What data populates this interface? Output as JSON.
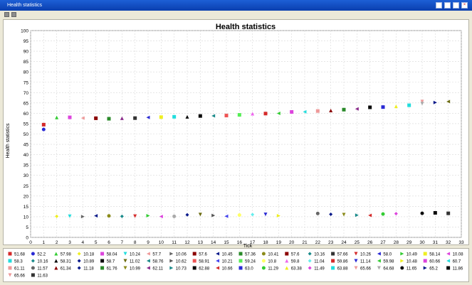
{
  "window": {
    "title": "Health statistics",
    "buttons": [
      "minimize-icon",
      "restore-icon",
      "pin-icon",
      "close-icon"
    ]
  },
  "chart_data": {
    "type": "scatter",
    "title": "Health statistics",
    "xlabel": "Tick",
    "ylabel": "Health statistics",
    "xlim": [
      0,
      33
    ],
    "ylim": [
      0,
      100
    ],
    "xticks": [
      0,
      1,
      2,
      3,
      4,
      5,
      6,
      7,
      8,
      9,
      10,
      11,
      12,
      13,
      14,
      15,
      16,
      17,
      18,
      19,
      20,
      21,
      22,
      23,
      24,
      25,
      26,
      27,
      28,
      29,
      30,
      31,
      32,
      33
    ],
    "yticks": [
      0,
      5,
      10,
      15,
      20,
      25,
      30,
      35,
      40,
      45,
      50,
      55,
      60,
      65,
      70,
      75,
      80,
      85,
      90,
      95,
      100
    ],
    "grid": true,
    "legend_position": "bottom",
    "series": [
      {
        "name": "51.68",
        "x": 1,
        "y": 54.5,
        "color": "#d42a2a",
        "shape": "square"
      },
      {
        "name": "52.2",
        "x": 1,
        "y": 52.2,
        "color": "#2a2ad4",
        "shape": "circle"
      },
      {
        "name": "57.98",
        "x": 2,
        "y": 57.98,
        "color": "#33cc33",
        "shape": "triangle-up"
      },
      {
        "name": "10.18",
        "x": 2,
        "y": 10.18,
        "color": "#eeee22",
        "shape": "diamond"
      },
      {
        "name": "58.04",
        "x": 3,
        "y": 58.04,
        "color": "#dd44dd",
        "shape": "square"
      },
      {
        "name": "10.24",
        "x": 3,
        "y": 10.24,
        "color": "#22dddd",
        "shape": "triangle-down"
      },
      {
        "name": "57.7",
        "x": 4,
        "y": 57.7,
        "color": "#ee9999",
        "shape": "triangle-left"
      },
      {
        "name": "10.06",
        "x": 4,
        "y": 10.06,
        "color": "#666666",
        "shape": "triangle-right"
      },
      {
        "name": "57.6",
        "x": 5,
        "y": 57.6,
        "color": "#8b0000",
        "shape": "square"
      },
      {
        "name": "10.45",
        "x": 5,
        "y": 10.45,
        "color": "#0a1a8a",
        "shape": "triangle-left"
      },
      {
        "name": "57.36",
        "x": 6,
        "y": 57.36,
        "color": "#2a8a2a",
        "shape": "square"
      },
      {
        "name": "10.41",
        "x": 6,
        "y": 10.41,
        "color": "#8b8b1a",
        "shape": "circle"
      },
      {
        "name": "57.6",
        "x": 7,
        "y": 57.6,
        "color": "#8a2a8a",
        "shape": "triangle-up"
      },
      {
        "name": "10.16",
        "x": 7,
        "y": 10.16,
        "color": "#1a8a8a",
        "shape": "diamond"
      },
      {
        "name": "57.66",
        "x": 8,
        "y": 57.66,
        "color": "#333333",
        "shape": "square"
      },
      {
        "name": "10.26",
        "x": 8,
        "y": 10.26,
        "color": "#d42a2a",
        "shape": "triangle-down"
      },
      {
        "name": "58.0",
        "x": 9,
        "y": 58.0,
        "color": "#2a2ad4",
        "shape": "triangle-left"
      },
      {
        "name": "10.49",
        "x": 9,
        "y": 10.49,
        "color": "#33cc33",
        "shape": "triangle-right"
      },
      {
        "name": "58.14",
        "x": 10,
        "y": 58.14,
        "color": "#eeee22",
        "shape": "square"
      },
      {
        "name": "10.08",
        "x": 10,
        "y": 10.08,
        "color": "#dd44dd",
        "shape": "triangle-left"
      },
      {
        "name": "58.3",
        "x": 11,
        "y": 58.3,
        "color": "#22dddd",
        "shape": "square"
      },
      {
        "name": "10.16",
        "x": 11,
        "y": 10.16,
        "color": "#aaaaaa",
        "shape": "circle"
      },
      {
        "name": "58.31",
        "x": 12,
        "y": 58.31,
        "color": "#0a0a0a",
        "shape": "triangle-up"
      },
      {
        "name": "10.89",
        "x": 12,
        "y": 10.89,
        "color": "#0a1a8a",
        "shape": "diamond"
      },
      {
        "name": "58.7",
        "x": 13,
        "y": 58.7,
        "color": "#0a0a0a",
        "shape": "square"
      },
      {
        "name": "11.02",
        "x": 13,
        "y": 11.02,
        "color": "#6b6b10",
        "shape": "triangle-down"
      },
      {
        "name": "58.76",
        "x": 14,
        "y": 58.76,
        "color": "#1a8a8a",
        "shape": "triangle-left"
      },
      {
        "name": "10.62",
        "x": 14,
        "y": 10.62,
        "color": "#555555",
        "shape": "triangle-right"
      },
      {
        "name": "58.91",
        "x": 15,
        "y": 58.91,
        "color": "#ee5555",
        "shape": "square"
      },
      {
        "name": "10.21",
        "x": 15,
        "y": 10.21,
        "color": "#4444ee",
        "shape": "triangle-left"
      },
      {
        "name": "59.24",
        "x": 16,
        "y": 59.24,
        "color": "#55ee55",
        "shape": "square"
      },
      {
        "name": "10.8",
        "x": 16,
        "y": 10.8,
        "color": "#ffff66",
        "shape": "circle"
      },
      {
        "name": "59.8",
        "x": 17,
        "y": 59.8,
        "color": "#ee66ee",
        "shape": "triangle-up"
      },
      {
        "name": "11.04",
        "x": 17,
        "y": 11.04,
        "color": "#66eeee",
        "shape": "diamond"
      },
      {
        "name": "59.86",
        "x": 18,
        "y": 59.86,
        "color": "#d42a2a",
        "shape": "square"
      },
      {
        "name": "11.14",
        "x": 18,
        "y": 11.14,
        "color": "#2a2ad4",
        "shape": "triangle-down"
      },
      {
        "name": "59.98",
        "x": 19,
        "y": 59.98,
        "color": "#33cc33",
        "shape": "triangle-left"
      },
      {
        "name": "10.48",
        "x": 19,
        "y": 10.48,
        "color": "#eeee22",
        "shape": "triangle-right"
      },
      {
        "name": "60.66",
        "x": 20,
        "y": 60.66,
        "color": "#dd44dd",
        "shape": "square"
      },
      {
        "name": "60.7",
        "x": 21,
        "y": 60.7,
        "color": "#22dddd",
        "shape": "triangle-left"
      },
      {
        "name": "61.11",
        "x": 22,
        "y": 61.11,
        "color": "#ee9999",
        "shape": "square"
      },
      {
        "name": "11.57",
        "x": 22,
        "y": 11.57,
        "color": "#666666",
        "shape": "circle"
      },
      {
        "name": "61.34",
        "x": 23,
        "y": 61.34,
        "color": "#8b0000",
        "shape": "triangle-up"
      },
      {
        "name": "11.18",
        "x": 23,
        "y": 11.18,
        "color": "#0a1a8a",
        "shape": "diamond"
      },
      {
        "name": "61.76",
        "x": 24,
        "y": 61.76,
        "color": "#2a8a2a",
        "shape": "square"
      },
      {
        "name": "10.99",
        "x": 24,
        "y": 10.99,
        "color": "#8b8b1a",
        "shape": "triangle-down"
      },
      {
        "name": "62.11",
        "x": 25,
        "y": 62.11,
        "color": "#8a2a8a",
        "shape": "triangle-left"
      },
      {
        "name": "10.73",
        "x": 25,
        "y": 10.73,
        "color": "#1a8a8a",
        "shape": "triangle-right"
      },
      {
        "name": "62.88",
        "x": 26,
        "y": 62.88,
        "color": "#0a0a0a",
        "shape": "square"
      },
      {
        "name": "10.66",
        "x": 26,
        "y": 10.66,
        "color": "#d42a2a",
        "shape": "triangle-left"
      },
      {
        "name": "63.0",
        "x": 27,
        "y": 63.0,
        "color": "#2a2ad4",
        "shape": "square"
      },
      {
        "name": "11.29",
        "x": 27,
        "y": 11.29,
        "color": "#33cc33",
        "shape": "circle"
      },
      {
        "name": "63.38",
        "x": 28,
        "y": 63.38,
        "color": "#eeee22",
        "shape": "triangle-up"
      },
      {
        "name": "11.49",
        "x": 28,
        "y": 11.49,
        "color": "#dd44dd",
        "shape": "diamond"
      },
      {
        "name": "63.88",
        "x": 29,
        "y": 63.88,
        "color": "#22dddd",
        "shape": "square"
      },
      {
        "name": "65.66",
        "x": 30,
        "y": 65.66,
        "color": "#ee9999",
        "shape": "triangle-down"
      },
      {
        "name": "64.68",
        "x": 30,
        "y": 64.68,
        "color": "#aaaaaa",
        "shape": "triangle-down"
      },
      {
        "name": "11.65",
        "x": 30,
        "y": 11.65,
        "color": "#0a0a0a",
        "shape": "circle"
      },
      {
        "name": "65.2",
        "x": 31,
        "y": 65.2,
        "color": "#0a1a8a",
        "shape": "triangle-right"
      },
      {
        "name": "11.86",
        "x": 31,
        "y": 11.86,
        "color": "#0a0a0a",
        "shape": "square"
      },
      {
        "name": "65.66",
        "x": 32,
        "y": 65.66,
        "color": "#6b6b10",
        "shape": "triangle-left"
      },
      {
        "name": "11.63",
        "x": 32,
        "y": 11.63,
        "color": "#333333",
        "shape": "square"
      }
    ],
    "legend_rows": [
      [
        "51.68",
        "52.2",
        "57.98",
        "10.18",
        "58.04",
        "10.24",
        "57.7",
        "10.06",
        "57.6",
        "10.45",
        "57.36",
        "10.41",
        "57.6",
        "10.16",
        "57.66",
        "10.26",
        "58.0",
        "10.49",
        "58.14",
        "10.08"
      ],
      [
        "58.3",
        "10.16",
        "58.31",
        "10.89",
        "58.7",
        "11.02",
        "58.76",
        "10.62",
        "58.91",
        "10.21",
        "59.24",
        "10.8",
        "59.8",
        "11.04",
        "59.86",
        "11.14",
        "59.98",
        "10.48",
        "60.66",
        "60.7"
      ],
      [
        "61.11",
        "11.57",
        "61.34",
        "11.18",
        "61.76",
        "10.99",
        "62.11",
        "10.73",
        "62.88",
        "10.66",
        "63.0",
        "11.29",
        "63.38",
        "11.49",
        "63.88",
        "65.66",
        "64.68",
        "11.65",
        "65.2",
        "11.86"
      ],
      [
        "65.66",
        "11.63"
      ]
    ]
  }
}
